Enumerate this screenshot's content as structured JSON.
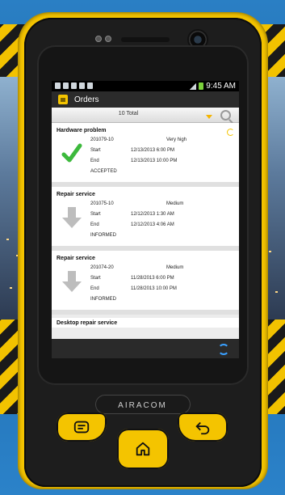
{
  "device": {
    "brand": "AIRACOM"
  },
  "status_bar": {
    "time": "9:45 AM"
  },
  "action_bar": {
    "title": "Orders"
  },
  "filter": {
    "total_label": "10 Total"
  },
  "orders": [
    {
      "name": "Hardware problem",
      "id": "201079-10",
      "priority": "Very high",
      "start_label": "Start",
      "start": "12/13/2013 6:00 PM",
      "end_label": "End",
      "end": "12/13/2013 10:00 PM",
      "status": "ACCEPTED",
      "icon": "check-icon"
    },
    {
      "name": "Repair service",
      "id": "201075-10",
      "priority": "Medium",
      "start_label": "Start",
      "start": "12/12/2013 1:30 AM",
      "end_label": "End",
      "end": "12/12/2013 4:06 AM",
      "status": "INFORMED",
      "icon": "down-arrow-icon"
    },
    {
      "name": "Repair service",
      "id": "201074-20",
      "priority": "Medium",
      "start_label": "Start",
      "start": "11/28/2013 6:00 PM",
      "end_label": "End",
      "end": "11/28/2013 10:00 PM",
      "status": "INFORMED",
      "icon": "down-arrow-icon"
    }
  ],
  "partial_order": {
    "name": "Desktop repair service"
  },
  "colors": {
    "accent": "#f4c400",
    "check": "#3cb93c",
    "sync": "#3aa0ff"
  }
}
